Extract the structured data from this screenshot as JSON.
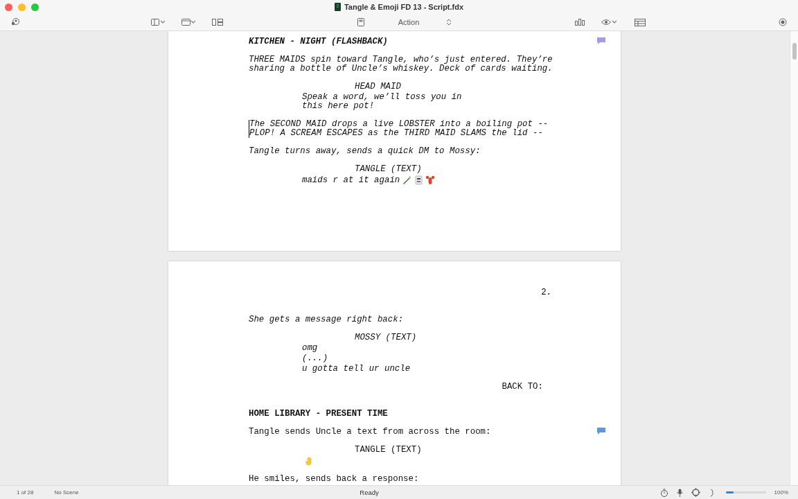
{
  "window": {
    "title": "Tangle & Emoji FD 13 - Script.fdx"
  },
  "toolbar": {
    "element_type": "Action"
  },
  "pages": [
    {
      "blocks": [
        {
          "kind": "scene",
          "text": "KITCHEN - NIGHT (FLASHBACK)",
          "italic": true,
          "comment": {
            "color": "#a29ce6"
          }
        },
        {
          "kind": "action",
          "text": "THREE MAIDS spin toward Tangle, who’s just entered. They’re\nsharing a bottle of Uncle’s whiskey. Deck of cards waiting.",
          "italic": true
        },
        {
          "kind": "character",
          "text": "HEAD MAID",
          "italic": true
        },
        {
          "kind": "dialogue",
          "text": "Speak a word, we’ll toss you in\nthis here pot!",
          "italic": true
        },
        {
          "kind": "action",
          "text": "The SECOND MAID drops a live LOBSTER into a boiling pot --\nPLOP! A SCREAM ESCAPES as the THIRD MAID SLAMS the lid --",
          "italic": true,
          "cursor": true
        },
        {
          "kind": "action",
          "text": "Tangle turns away, sends a quick DM to Mossy:",
          "italic": true
        },
        {
          "kind": "character",
          "text": "TANGLE (TEXT)",
          "italic": true
        },
        {
          "kind": "dialogue",
          "text": "maids r at it again",
          "italic": true,
          "emoji": [
            {
              "kind": "bottle"
            },
            {
              "kind": "card"
            },
            {
              "kind": "lobster"
            }
          ]
        }
      ]
    },
    {
      "number": "2.",
      "blocks": [
        {
          "kind": "action",
          "text": "She gets a message right back:",
          "italic": true
        },
        {
          "kind": "character",
          "text": "MOSSY (TEXT)",
          "italic": true
        },
        {
          "kind": "dialogue",
          "text": "omg",
          "italic": true
        },
        {
          "kind": "parenthetical",
          "text": "(...)",
          "italic": true
        },
        {
          "kind": "dialogue",
          "text": "u gotta tell ur uncle",
          "italic": true
        },
        {
          "kind": "transition",
          "text": "BACK TO:",
          "italic": false
        },
        {
          "kind": "scene",
          "text": "HOME LIBRARY - PRESENT TIME",
          "italic": false
        },
        {
          "kind": "action",
          "text": "Tangle sends Uncle a text from across the room:",
          "italic": false,
          "comment": {
            "color": "#5a9be0"
          }
        },
        {
          "kind": "character",
          "text": "TANGLE (TEXT)",
          "italic": false
        },
        {
          "kind": "dialogue",
          "emoji": [
            {
              "kind": "hand"
            }
          ]
        },
        {
          "kind": "action",
          "text": "He smiles, sends back a response:",
          "italic": false
        }
      ]
    }
  ],
  "status_bar": {
    "page": "1 of 28",
    "scene": "No Scene",
    "state": "Ready",
    "zoom": {
      "level": 0.2
    },
    "zoom_label": "100%"
  }
}
